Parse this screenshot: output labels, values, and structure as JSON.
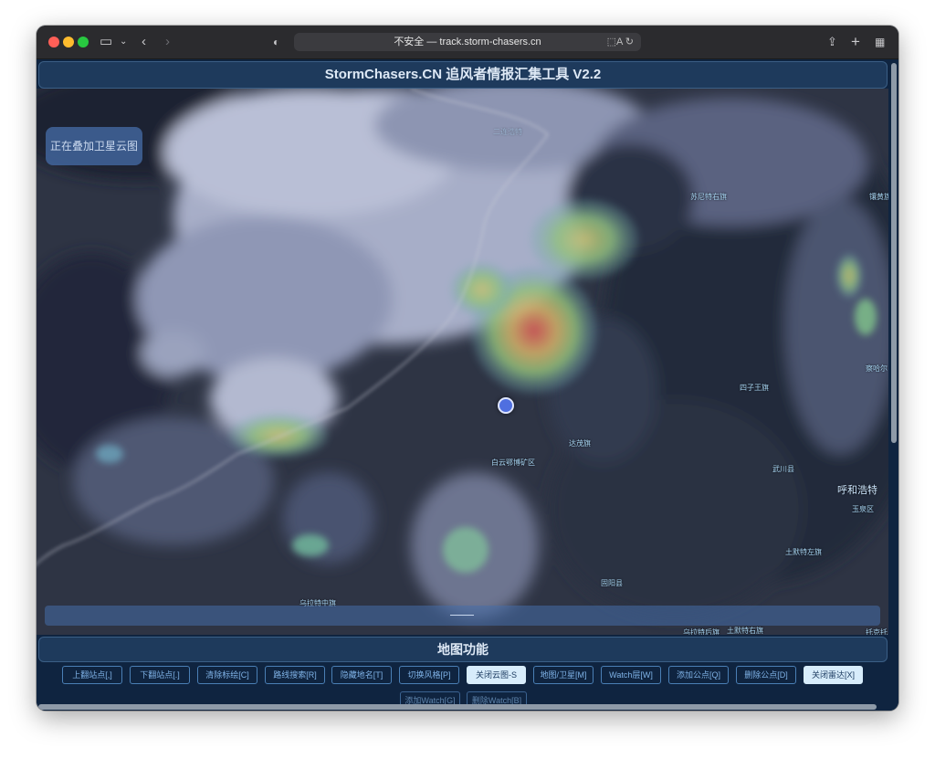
{
  "browser": {
    "address": "不安全 — track.storm-chasers.cn",
    "addr_icons": "⬚A ↻"
  },
  "app": {
    "title": "StormChasers.CN 追风者情报汇集工具 V2.2",
    "overlay_status": "正在叠加卫星云图"
  },
  "map": {
    "labels": [
      {
        "text": "苏尼特右旗"
      },
      {
        "text": "镶黄旗"
      },
      {
        "text": "四子王旗"
      },
      {
        "text": "察哈尔"
      },
      {
        "text": "达茂旗"
      },
      {
        "text": "白云鄂博矿区"
      },
      {
        "text": "武川县"
      },
      {
        "text": "呼和浩特"
      },
      {
        "text": "玉泉区"
      },
      {
        "text": "土默特左旗"
      },
      {
        "text": "固阳县"
      },
      {
        "text": "乌拉特中旗"
      },
      {
        "text": "乌拉特后旗"
      },
      {
        "text": "土默特右旗"
      },
      {
        "text": "托克托"
      },
      {
        "text": "二连浩特"
      }
    ]
  },
  "functions": {
    "title": "地图功能",
    "buttons": [
      {
        "label": "上翻站点[,]"
      },
      {
        "label": "下翻站点[.]"
      },
      {
        "label": "清除标绘[C]"
      },
      {
        "label": "路线搜索[R]"
      },
      {
        "label": "隐藏地名[T]"
      },
      {
        "label": "切换风格[P]"
      },
      {
        "label": "关闭云图-S"
      },
      {
        "label": "地图/卫星[M]"
      },
      {
        "label": "Watch层[W]"
      },
      {
        "label": "添加公点[Q]"
      },
      {
        "label": "删除公点[D]"
      },
      {
        "label": "关闭雷达[X]"
      },
      {
        "label": "添加Watch[G]"
      },
      {
        "label": "删除Watch[B]"
      }
    ]
  },
  "colors": {
    "page_bg": "#0f2440",
    "panel": "#1e3a5c",
    "button_border": "#4a7fb5",
    "active_button": "#d7ecfb"
  }
}
